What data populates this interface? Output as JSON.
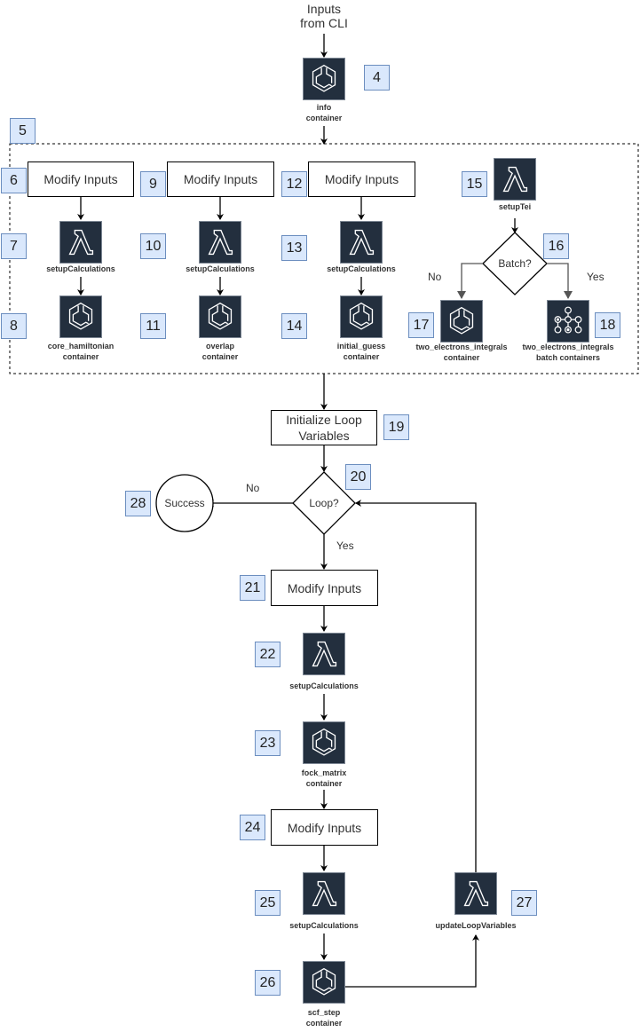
{
  "diagram": {
    "input_label": "Inputs\nfrom CLI",
    "info_container": {
      "badge": "4",
      "label_line1": "info",
      "label_line2": "container",
      "icon": "container-icon"
    },
    "group_badge": "5",
    "columns": [
      {
        "modify_badge": "6",
        "modify_label": "Modify Inputs",
        "lambda_badge": "7",
        "lambda_label": "setupCalculations",
        "container_badge": "8",
        "container_line1": "core_hamiltonian",
        "container_line2": "container"
      },
      {
        "modify_badge": "9",
        "modify_label": "Modify Inputs",
        "lambda_badge": "10",
        "lambda_label": "setupCalculations",
        "container_badge": "11",
        "container_line1": "overlap",
        "container_line2": "container"
      },
      {
        "modify_badge": "12",
        "modify_label": "Modify Inputs",
        "lambda_badge": "13",
        "lambda_label": "setupCalculations",
        "container_badge": "14",
        "container_line1": "initial_guess",
        "container_line2": "container"
      }
    ],
    "tei": {
      "lambda_badge": "15",
      "lambda_label": "setupTei",
      "decision_badge": "16",
      "decision_label": "Batch?",
      "no_label": "No",
      "yes_label": "Yes",
      "single_badge": "17",
      "single_line1": "two_electrons_integrals",
      "single_line2": "container",
      "batch_badge": "18",
      "batch_line1": "two_electrons_integrals",
      "batch_line2": "batch containers"
    },
    "init_loop": {
      "badge": "19",
      "label_line1": "Initialize Loop",
      "label_line2": "Variables"
    },
    "loop_decision": {
      "badge": "20",
      "label": "Loop?",
      "no_label": "No",
      "yes_label": "Yes"
    },
    "success": {
      "badge": "28",
      "label": "Success"
    },
    "loop_body": {
      "modify1_badge": "21",
      "modify1_label": "Modify Inputs",
      "lambda1_badge": "22",
      "lambda1_label": "setupCalculations",
      "fock_badge": "23",
      "fock_line1": "fock_matrix",
      "fock_line2": "container",
      "modify2_badge": "24",
      "modify2_label": "Modify Inputs",
      "lambda2_badge": "25",
      "lambda2_label": "setupCalculations",
      "scf_badge": "26",
      "scf_line1": "scf_step",
      "scf_line2": "container",
      "update_badge": "27",
      "update_label": "updateLoopVariables"
    }
  }
}
